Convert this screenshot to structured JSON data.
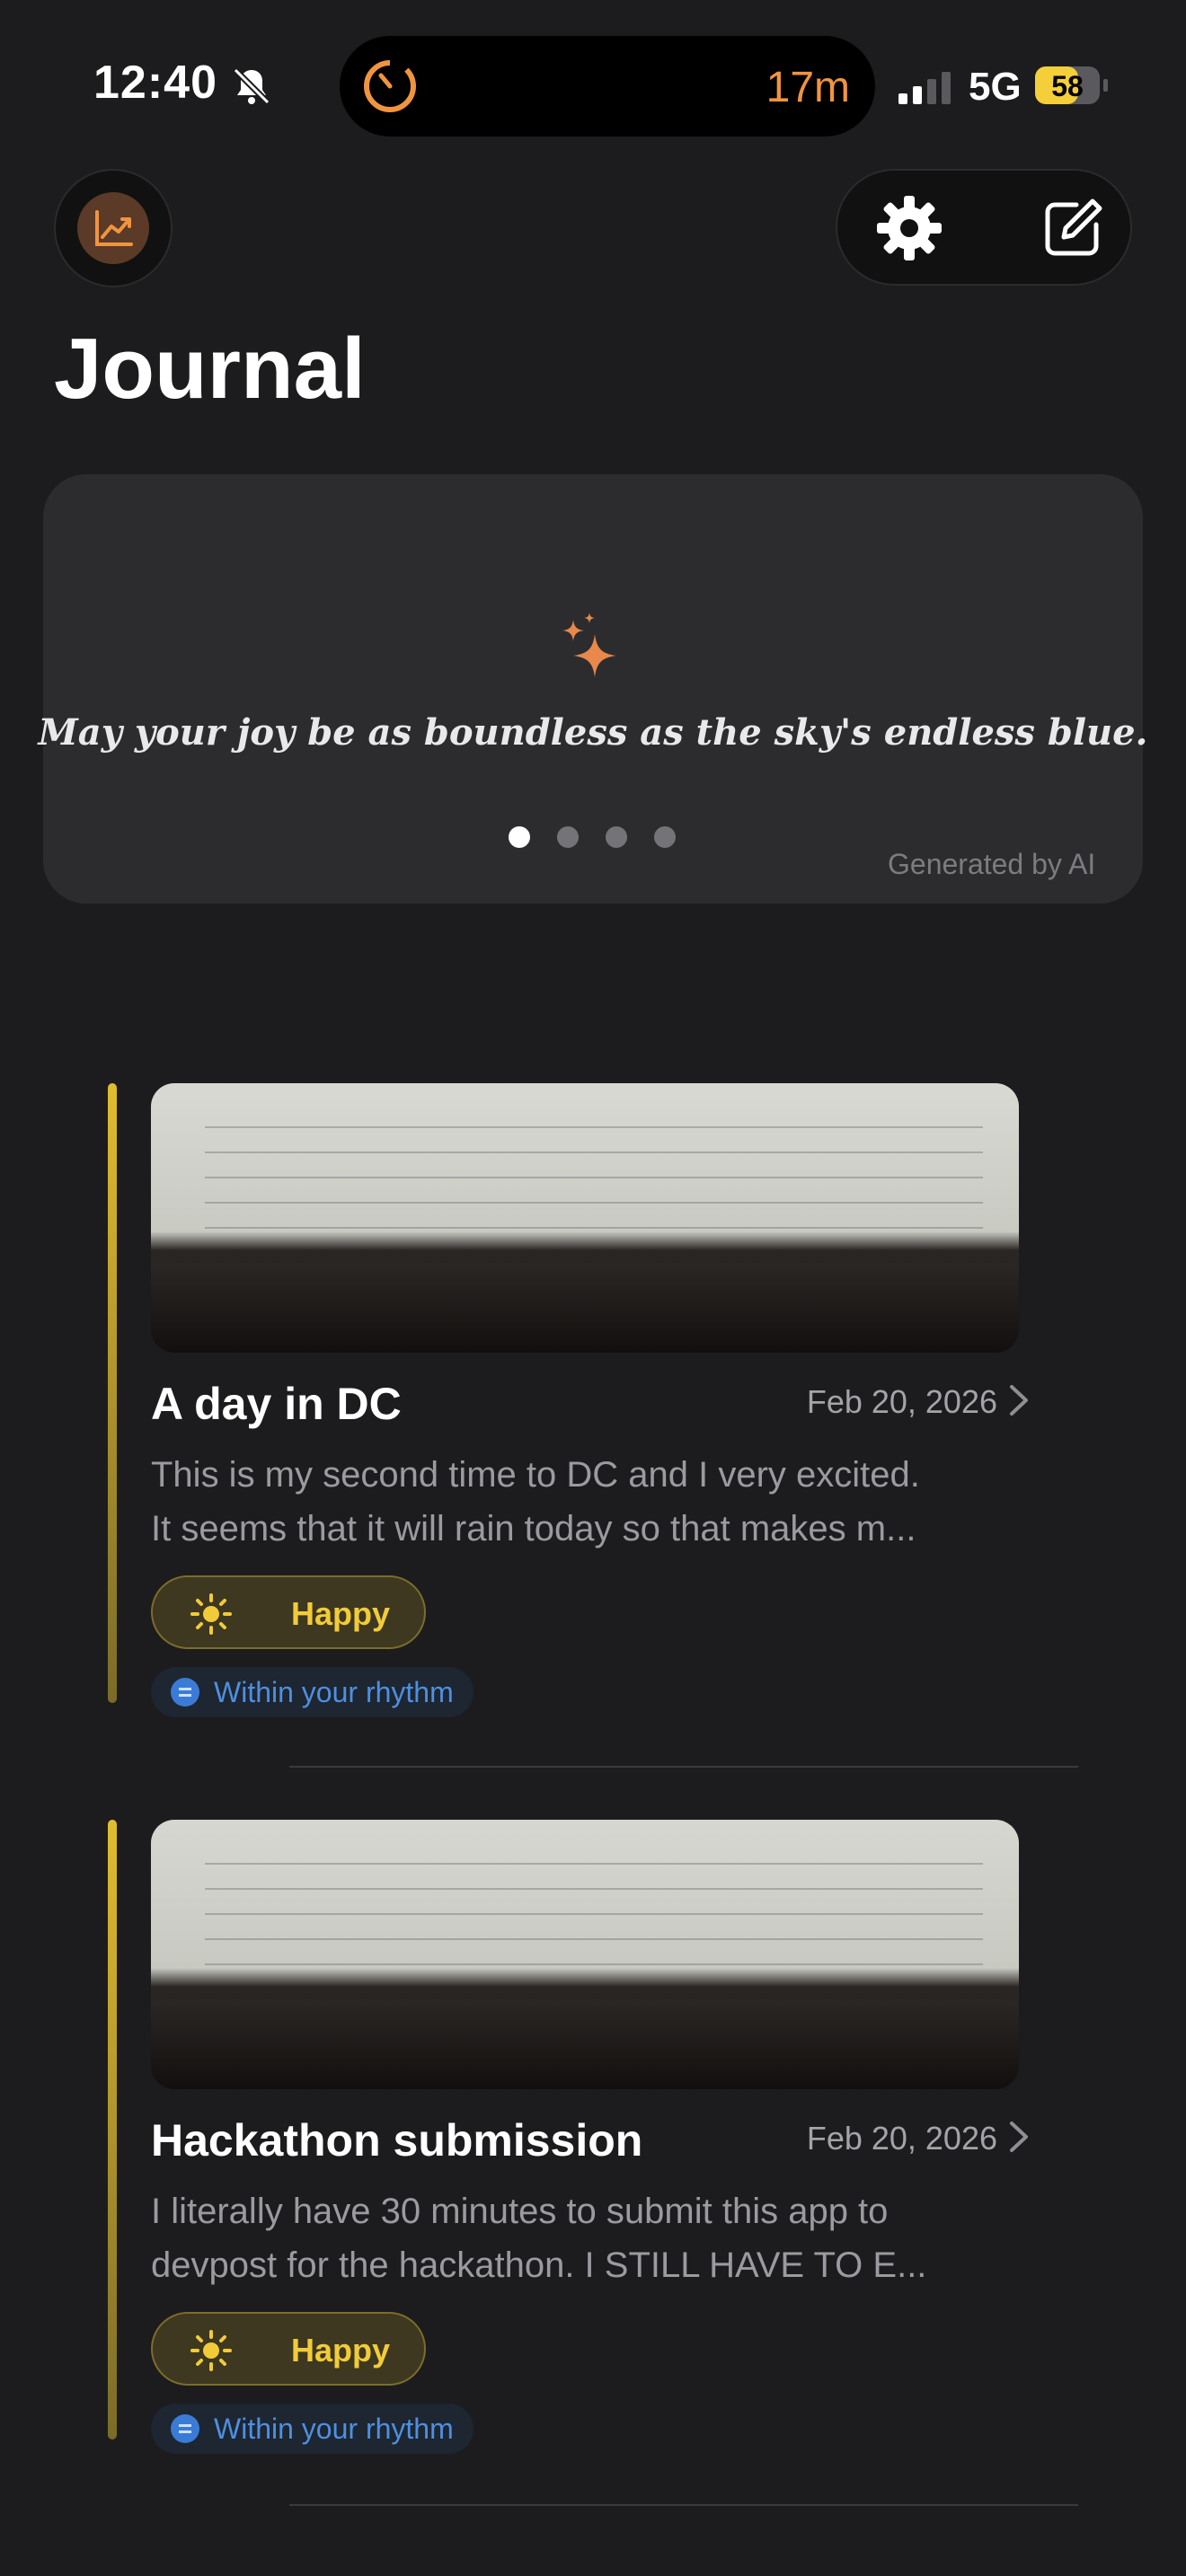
{
  "status_bar": {
    "time": "12:40",
    "timer": "17m",
    "network": "5G",
    "battery": "58"
  },
  "header": {
    "title": "Journal"
  },
  "quote_card": {
    "quote": "May your joy be as boundless as the sky's endless blue.",
    "footer": "Generated by AI",
    "page_count": 4,
    "active_page": 0
  },
  "entries": [
    {
      "title": "A day in DC",
      "date": "Feb 20, 2026",
      "preview_line1": "This is my second time to DC and I  very excited.",
      "preview_line2": "It seems that it will rain today so that makes m...",
      "mood": "Happy",
      "rhythm": "Within your rhythm"
    },
    {
      "title": "Hackathon submission",
      "date": "Feb 20, 2026",
      "preview_line1": "I literally have 30 minutes to submit this app to",
      "preview_line2": "devpost for the hackathon. I STILL HAVE TO E...",
      "mood": "Happy",
      "rhythm": "Within your rhythm"
    }
  ],
  "colors": {
    "background": "#1c1c1e",
    "accent_orange": "#f0953f",
    "mood_yellow": "#f1cb3a",
    "rhythm_blue": "#4f8fe0"
  },
  "icons": [
    "bell-slash-icon",
    "timer-ring-icon",
    "signal-icon",
    "battery-icon",
    "chart-icon",
    "gear-icon",
    "compose-icon",
    "sparkle-icon",
    "chevron-right-icon",
    "sun-icon",
    "equals-icon"
  ]
}
